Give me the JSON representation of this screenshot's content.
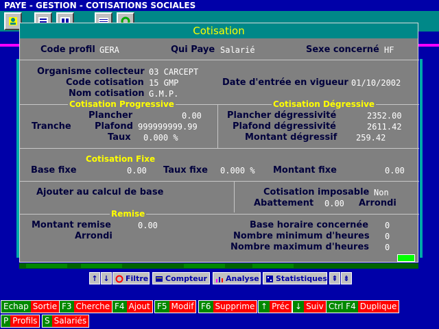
{
  "window": {
    "title": "PAYE - GESTION - COTISATIONS SOCIALES"
  },
  "dialog": {
    "title": "Cotisation",
    "code_profil_label": "Code profil",
    "code_profil_value": "GERA",
    "qui_paye_label": "Qui Paye",
    "qui_paye_value": "Salarié",
    "sexe_label": "Sexe concerné",
    "sexe_value": "HF",
    "organisme_label": "Organisme collecteur",
    "organisme_value": "03 CARCEPT",
    "code_cotisation_label": "Code cotisation",
    "code_cotisation_value": "15 GMP",
    "nom_cotisation_label": "Nom cotisation",
    "nom_cotisation_value": "G.M.P.",
    "date_label": "Date d'entrée en vigueur",
    "date_value": "01/10/2002",
    "prog": {
      "title": "Cotisation Progressive",
      "tranche_label": "Tranche",
      "plancher_label": "Plancher",
      "plancher_value": "0.00",
      "plafond_label": "Plafond",
      "plafond_value": "999999999.99",
      "taux_label": "Taux",
      "taux_value": "0.000 %"
    },
    "degr": {
      "title": "Cotisation Dégressive",
      "plancher_label": "Plancher dégressivité",
      "plancher_value": "2352.00",
      "plafond_label": "Plafond dégressivité",
      "plafond_value": "2611.42",
      "montant_label": "Montant dégressif",
      "montant_value": "259.42"
    },
    "fixe": {
      "title": "Cotisation Fixe",
      "base_label": "Base fixe",
      "base_value": "0.00",
      "taux_label": "Taux fixe",
      "taux_value": "0.000 %",
      "montant_label": "Montant fixe",
      "montant_value": "0.00"
    },
    "ajouter_label": "Ajouter au calcul de base",
    "imposable_label": "Cotisation imposable",
    "imposable_value": "Non",
    "abattement_label": "Abattement",
    "abattement_value": "0.00",
    "arrondi_label": "Arrondi",
    "remise": {
      "title": "Remise",
      "montant_label": "Montant remise",
      "montant_value": "0.00",
      "arrondi_label": "Arrondi",
      "base_horaire_label": "Base horaire concernée",
      "base_horaire_value": "0",
      "min_heures_label": "Nombre minimum d'heures",
      "min_heures_value": "0",
      "max_heures_label": "Nombre maximum d'heures",
      "max_heures_value": "0"
    }
  },
  "cmdbar": {
    "filtre": "Filtre",
    "compteur": "Compteur",
    "analyse": "Analyse",
    "statistiques": "Statistiques"
  },
  "fkeys": [
    {
      "key": "Echap",
      "label": "Sortie"
    },
    {
      "key": "F3",
      "label": "Cherche"
    },
    {
      "key": "F4",
      "label": "Ajout"
    },
    {
      "key": "F5",
      "label": "Modif"
    },
    {
      "key": "F6",
      "label": "Supprime"
    },
    {
      "key": "↑",
      "label": "Préc"
    },
    {
      "key": "↓",
      "label": "Suiv"
    },
    {
      "key": "Ctrl F4",
      "label": "Duplique"
    },
    {
      "key": "P",
      "label": "Profils"
    },
    {
      "key": "S",
      "label": "Salariés"
    }
  ],
  "colors": {
    "accent": "#ffff00",
    "title_bg": "#008888",
    "background": "#0000a8",
    "dialog_bg": "#808080"
  }
}
